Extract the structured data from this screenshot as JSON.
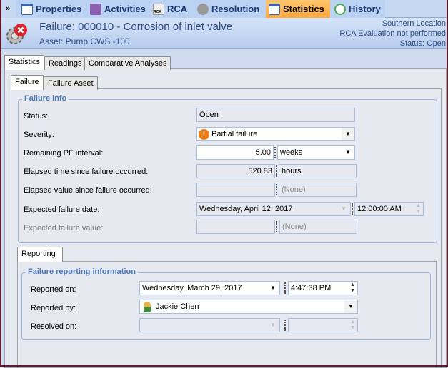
{
  "toolbar": {
    "tabs": [
      {
        "label": "Properties"
      },
      {
        "label": "Activities"
      },
      {
        "label": "RCA"
      },
      {
        "label": "Resolution"
      },
      {
        "label": "Statistics"
      },
      {
        "label": "History"
      }
    ],
    "rca_icon_text": "RCA"
  },
  "header": {
    "title": "Failure: 000010 - Corrosion of inlet valve",
    "asset": "Asset: Pump CWS -100",
    "location": "Southern Location",
    "rca_status": "RCA Evaluation not performed",
    "status": "Status: Open"
  },
  "tabs": {
    "main": [
      "Statistics",
      "Readings",
      "Comparative Analyses"
    ],
    "sub": [
      "Failure",
      "Failure Asset"
    ],
    "reporting": "Reporting"
  },
  "failure_info": {
    "title": "Failure info",
    "status_label": "Status:",
    "status": "Open",
    "severity_label": "Severity:",
    "severity": "Partial failure",
    "pf_label": "Remaining PF interval:",
    "pf_value": "5.00",
    "pf_unit": "weeks",
    "elapsed_time_label": "Elapsed time since failure occurred:",
    "elapsed_time": "520.83",
    "elapsed_time_unit": "hours",
    "elapsed_value_label": "Elapsed value since failure occurred:",
    "elapsed_value_unit": "(None)",
    "expected_date_label": "Expected failure date:",
    "expected_date": "Wednesday, April 12, 2017",
    "expected_time": "12:00:00 AM",
    "expected_value_label": "Expected failure value:",
    "expected_value_unit": "(None)"
  },
  "reporting": {
    "title": "Failure reporting information",
    "reported_on_label": "Reported on:",
    "reported_on_date": "Wednesday, March 29, 2017",
    "reported_on_time": "4:47:38 PM",
    "reported_by_label": "Reported by:",
    "reported_by": "Jackie Chen",
    "resolved_on_label": "Resolved on:"
  }
}
